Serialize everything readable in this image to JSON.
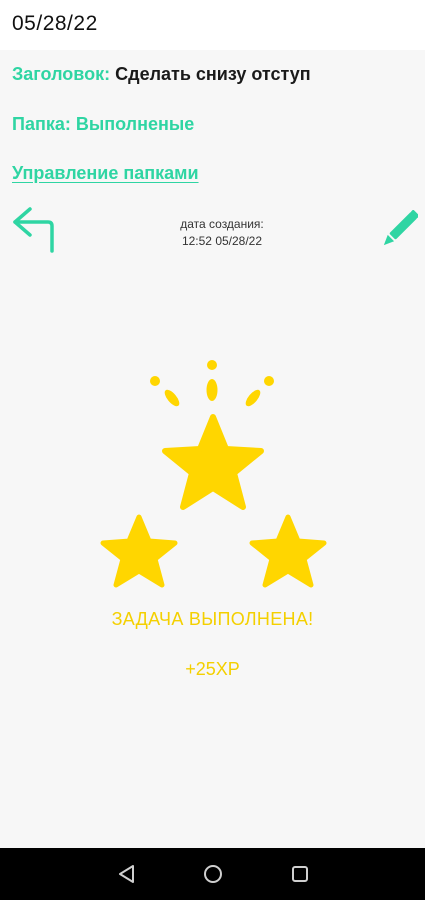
{
  "status_bar": {
    "date": "05/28/22"
  },
  "task": {
    "title_label": "Заголовок:",
    "title_value": "Сделать снизу отступ",
    "folder_label": "Папка:",
    "folder_value": "Выполненые",
    "manage_folders_link": "Управление папками"
  },
  "toolbar": {
    "back_icon": "back-arrow-icon",
    "edit_icon": "pencil-icon",
    "created_label": "дата создания:",
    "created_value": "12:52 05/28/22"
  },
  "completion": {
    "message": "ЗАДАЧА ВЫПОЛНЕНА!",
    "reward": "+25XP",
    "stars_icon": "three-stars-icon"
  },
  "nav_bar": {
    "back_icon": "triangle-back-icon",
    "home_icon": "circle-home-icon",
    "recent_icon": "square-recents-icon"
  },
  "colors": {
    "accent": "#2fd5a3",
    "star_yellow": "#ffd600",
    "text_yellow": "#f4d000",
    "background": "#f7f7f7"
  }
}
